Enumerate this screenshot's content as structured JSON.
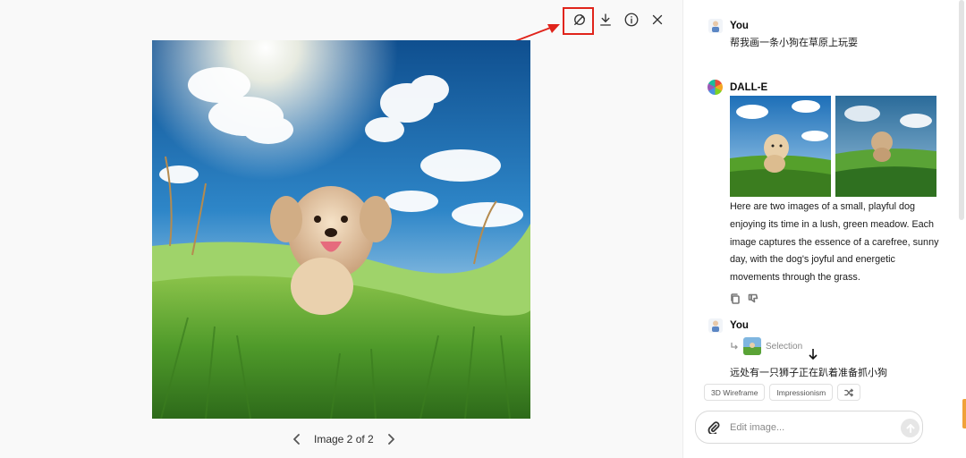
{
  "viewer": {
    "pager_label": "Image 2 of 2",
    "toolbar": {
      "select_icon": "brush-select-icon",
      "download_icon": "download-icon",
      "info_icon": "info-icon",
      "close_icon": "close-icon"
    }
  },
  "chat": {
    "messages": [
      {
        "author": "You",
        "text": "帮我画一条小狗在草原上玩耍"
      },
      {
        "author": "DALL-E",
        "text": "Here are two images of a small, playful dog enjoying its time in a lush, green meadow. Each image captures the essence of a carefree, sunny day, with the dog's joyful and energetic movements through the grass."
      },
      {
        "author": "You",
        "selection_label": "Selection",
        "text": "远处有一只狮子正在趴着准备抓小狗"
      }
    ],
    "chips": [
      "3D Wireframe",
      "Impressionism"
    ],
    "input": {
      "placeholder": "Edit image..."
    }
  },
  "colors": {
    "highlight": "#e0241b",
    "accent_tab": "#f0a23a"
  }
}
